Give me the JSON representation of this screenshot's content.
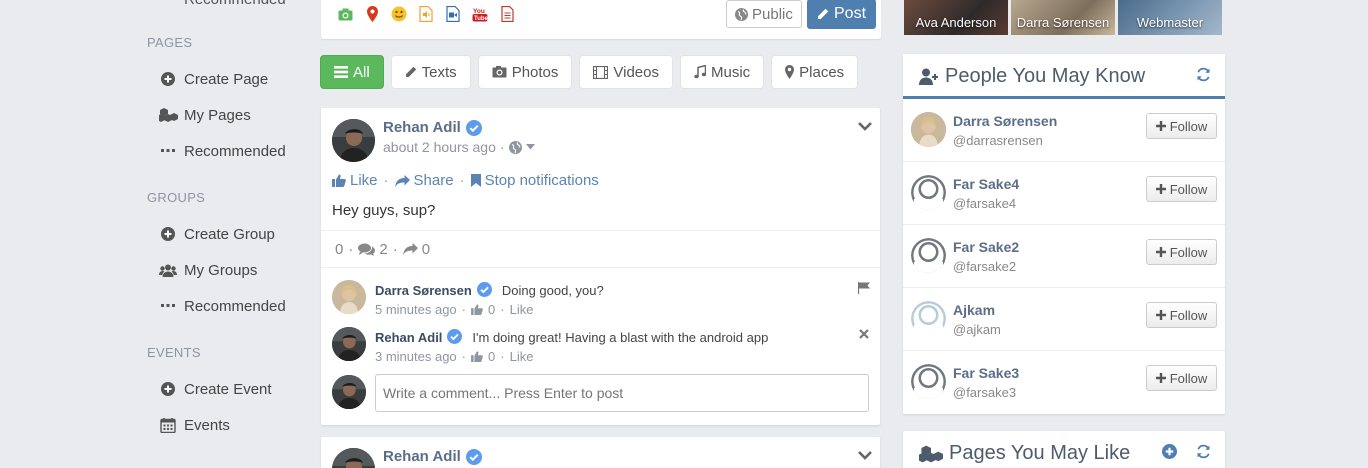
{
  "sidebar": {
    "cut_item": "Recommended",
    "sections": [
      {
        "heading": "PAGES",
        "items": [
          {
            "label": "Create Page",
            "icon": "plus-circle-icon"
          },
          {
            "label": "My Pages",
            "icon": "cubes-icon"
          },
          {
            "label": "Recommended",
            "icon": "ellipsis-icon"
          }
        ]
      },
      {
        "heading": "GROUPS",
        "items": [
          {
            "label": "Create Group",
            "icon": "plus-circle-icon"
          },
          {
            "label": "My Groups",
            "icon": "users-icon"
          },
          {
            "label": "Recommended",
            "icon": "ellipsis-icon"
          }
        ]
      },
      {
        "heading": "EVENTS",
        "items": [
          {
            "label": "Create Event",
            "icon": "plus-circle-icon"
          },
          {
            "label": "Events",
            "icon": "calendar-icon"
          }
        ]
      }
    ]
  },
  "composer": {
    "icons": [
      "camera-icon",
      "map-pin-icon",
      "smiley-icon",
      "audio-file-icon",
      "video-file-icon",
      "youtube-icon",
      "document-icon"
    ],
    "public_label": "Public",
    "post_label": "Post"
  },
  "filters": [
    {
      "label": "All",
      "icon": "list-icon",
      "active": true
    },
    {
      "label": "Texts",
      "icon": "pencil-icon",
      "active": false
    },
    {
      "label": "Photos",
      "icon": "photo-icon",
      "active": false
    },
    {
      "label": "Videos",
      "icon": "film-icon",
      "active": false
    },
    {
      "label": "Music",
      "icon": "music-icon",
      "active": false
    },
    {
      "label": "Places",
      "icon": "map-marker-icon",
      "active": false
    }
  ],
  "post": {
    "author": "Rehan Adil",
    "time": "about 2 hours ago",
    "actions": {
      "like": "Like",
      "share": "Share",
      "stop": "Stop notifications"
    },
    "text": "Hey guys, sup?",
    "stats": {
      "likes": "0",
      "comments": "2",
      "shares": "0"
    },
    "comments": [
      {
        "author": "Darra Sørensen",
        "text": "Doing good, you?",
        "time": "5 minutes ago",
        "likes": "0",
        "like_label": "Like"
      },
      {
        "author": "Rehan Adil",
        "text": "I'm doing great! Having a blast with the android app",
        "time": "3 minutes ago",
        "likes": "0",
        "like_label": "Like"
      }
    ],
    "comment_placeholder": "Write a comment... Press Enter to post"
  },
  "post2": {
    "author": "Rehan Adil"
  },
  "photos": [
    "Ava Anderson",
    "Darra Sørensen",
    "Webmaster"
  ],
  "people": {
    "title": "People You May Know",
    "follow_label": "Follow",
    "items": [
      {
        "name": "Darra Sørensen",
        "handle": "@darrasrensen"
      },
      {
        "name": "Far Sake4",
        "handle": "@farsake4"
      },
      {
        "name": "Far Sake2",
        "handle": "@farsake2"
      },
      {
        "name": "Ajkam",
        "handle": "@ajkam"
      },
      {
        "name": "Far Sake3",
        "handle": "@farsake3"
      }
    ]
  },
  "pages_like": {
    "title": "Pages You May Like"
  },
  "colors": {
    "accent": "#4f7fae",
    "green": "#5cb85c",
    "link": "#5b84b1",
    "verified": "#5d9cec"
  }
}
